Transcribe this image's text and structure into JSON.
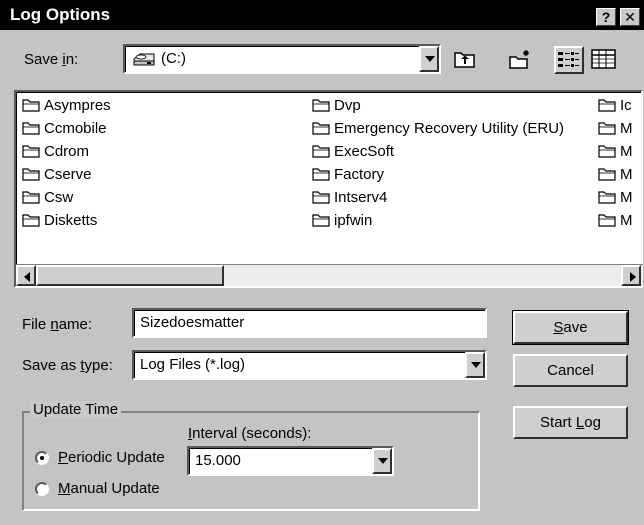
{
  "window": {
    "title": "Log Options"
  },
  "titlebar_buttons": [
    {
      "label": "?",
      "icon": "help-icon"
    },
    {
      "label": "✕",
      "icon": "close-icon"
    }
  ],
  "save_in": {
    "label_pre": "Save ",
    "label_u": "i",
    "label_post": "n:",
    "value": "(C:)",
    "icon": "drive-icon"
  },
  "toolbar": {
    "up_folder": "up-one-level-icon",
    "new_folder": "new-folder-icon",
    "list_view": "list-view-icon",
    "details_view": "details-view-icon"
  },
  "files": {
    "col1": [
      "Asympres",
      "Ccmobile",
      "Cdrom",
      "Cserve",
      "Csw",
      "Disketts"
    ],
    "col2": [
      "Dvp",
      "Emergency Recovery Utility (ERU)",
      "ExecSoft",
      "Factory",
      "Intserv4",
      "ipfwin"
    ],
    "col3": [
      "Ic",
      "M",
      "M",
      "M",
      "M",
      "M"
    ]
  },
  "file_name": {
    "label_pre": "File ",
    "label_u": "n",
    "label_post": "ame:",
    "value": "Sizedoesmatter"
  },
  "save_as_type": {
    "label_pre": "Save as ",
    "label_u": "t",
    "label_post": "ype:",
    "value": "Log Files (*.log)"
  },
  "buttons": {
    "save_u": "S",
    "save_rest": "ave",
    "cancel": "Cancel",
    "start_log_pre": "Start ",
    "start_log_u": "L",
    "start_log_post": "og"
  },
  "update_time": {
    "legend": "Update Time",
    "interval_label_u": "I",
    "interval_label_rest": "nterval (seconds):",
    "interval_value": "15.000",
    "periodic_u": "P",
    "periodic_rest": "eriodic Update",
    "manual_u": "M",
    "manual_rest": "anual Update",
    "selected": "periodic"
  }
}
